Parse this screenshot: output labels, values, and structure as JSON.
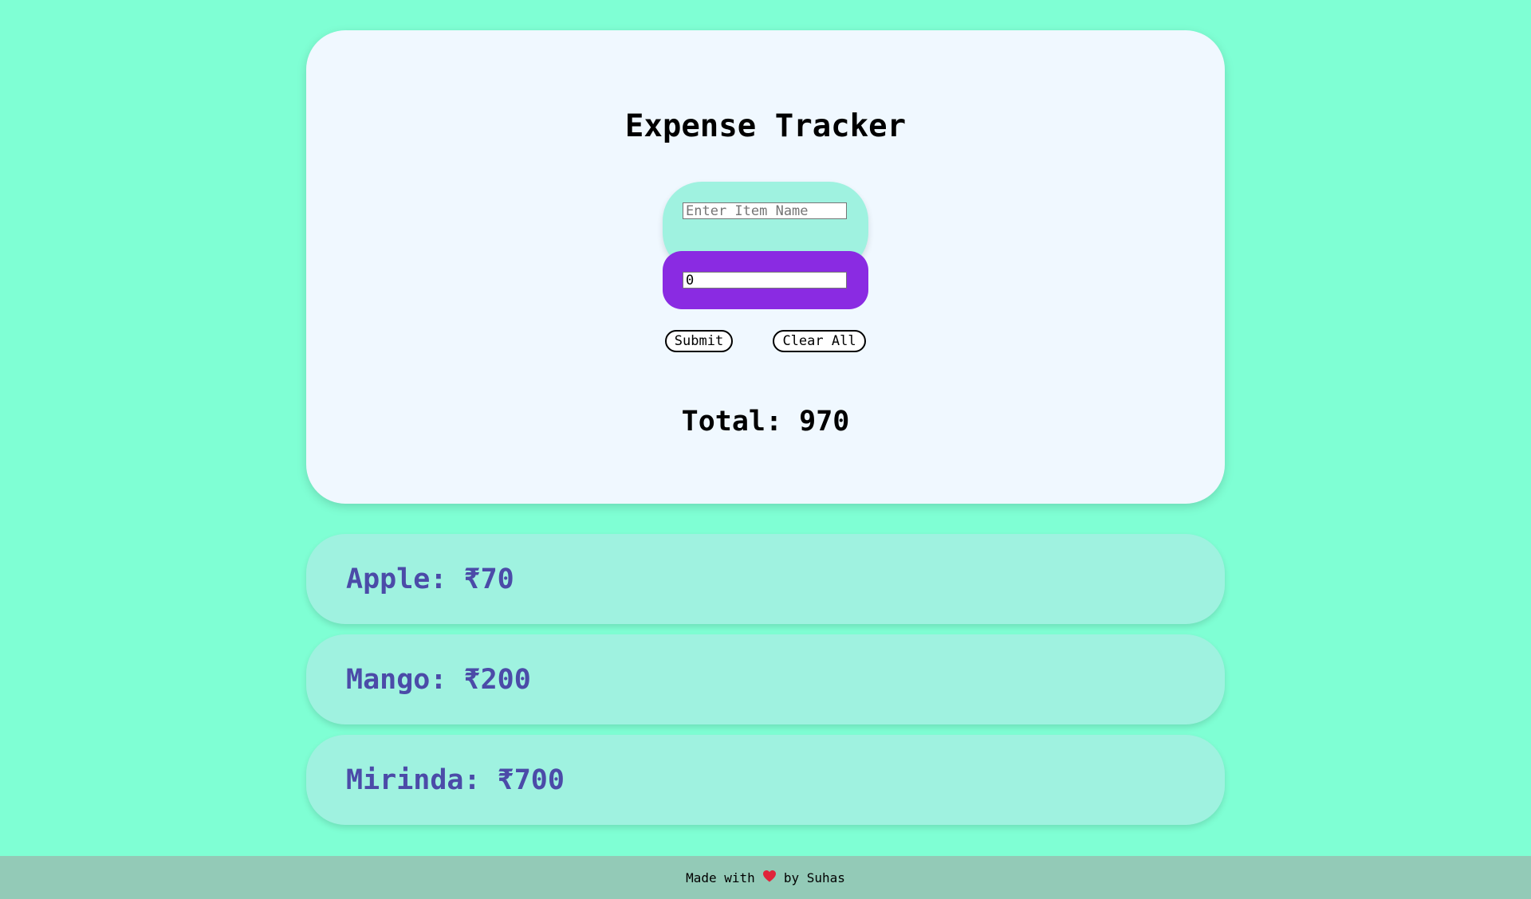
{
  "header": {
    "title": "Expense Tracker"
  },
  "form": {
    "item_name_placeholder": "Enter Item Name",
    "item_name_value": "",
    "amount_value": "0",
    "submit_label": "Submit",
    "clear_label": "Clear All"
  },
  "summary": {
    "total_text": "Total: 970"
  },
  "expenses": [
    {
      "text": "Apple: ₹70"
    },
    {
      "text": "Mango: ₹200"
    },
    {
      "text": "Mirinda: ₹700"
    }
  ],
  "footer": {
    "prefix": "Made with",
    "icon": "heart-icon",
    "suffix": "by Suhas"
  },
  "colors": {
    "background": "#7fffd4",
    "card": "#f0f8ff",
    "input_wrap": "#8a2be2",
    "expense_card": "#9ff2e0",
    "expense_text": "#4b4ba8",
    "footer": "#93cab7",
    "heart": "#e0243a"
  }
}
